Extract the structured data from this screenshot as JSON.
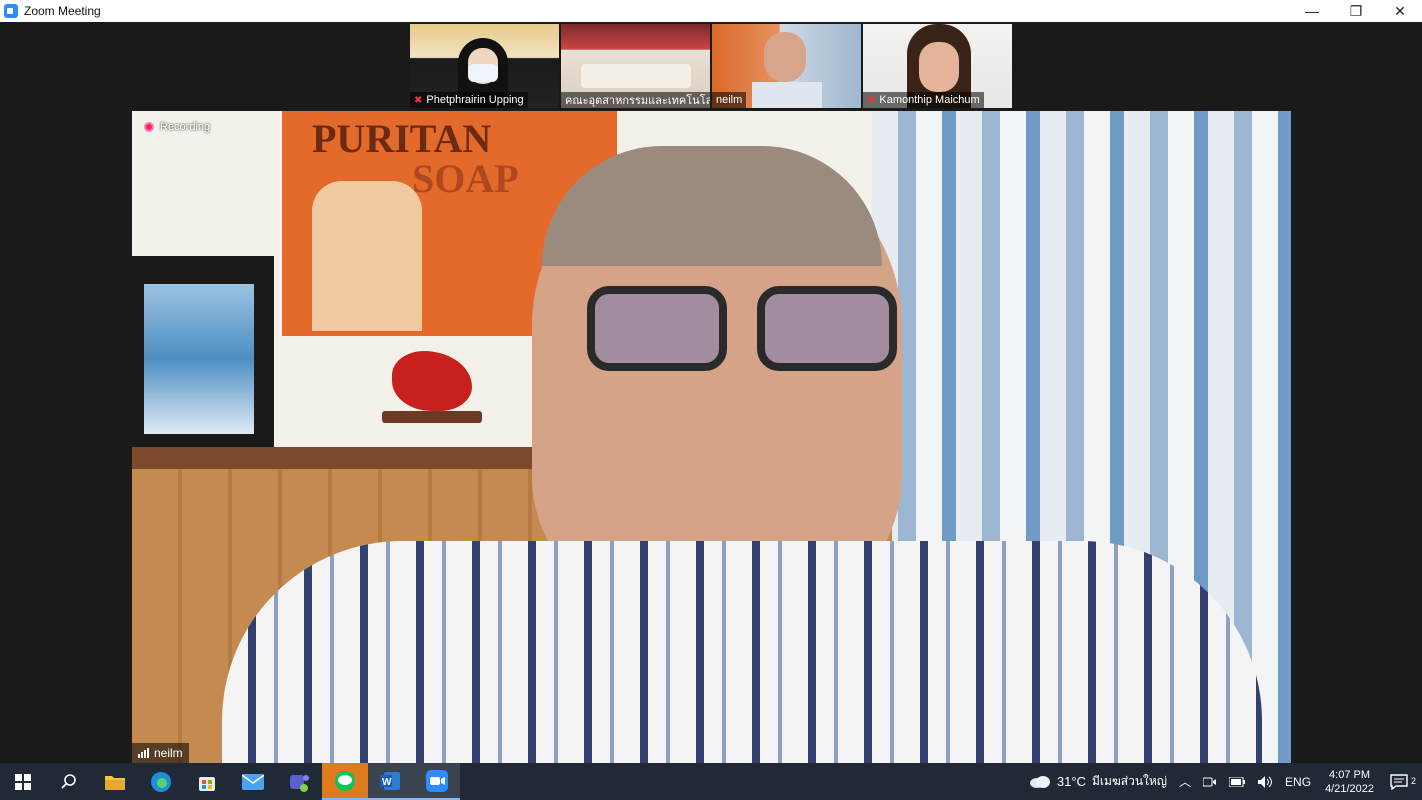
{
  "window": {
    "title": "Zoom Meeting",
    "controls": [
      "—",
      "❐",
      "✕"
    ]
  },
  "participants": [
    {
      "name": "Phetphrairin  Upping",
      "muted": true
    },
    {
      "name": "คณะอุตสาหกรรมและเทคโนโล...",
      "muted": false
    },
    {
      "name": "neilm",
      "muted": false
    },
    {
      "name": "Kamonthip Maichum",
      "muted": true
    }
  ],
  "main": {
    "recording_label": "Recording",
    "speaker_name": "neilm",
    "poster_text_1": "PURITAN",
    "poster_text_2": "SOAP"
  },
  "taskbar": {
    "weather": "31°C",
    "location": "มีเมฆส่วนใหญ่",
    "language": "ENG",
    "time": "4:07 PM",
    "date": "4/21/2022",
    "notifications": "2"
  },
  "colors": {
    "accent": "#2d8cff",
    "taskbar": "#1f2a36",
    "record": "#e33333"
  }
}
